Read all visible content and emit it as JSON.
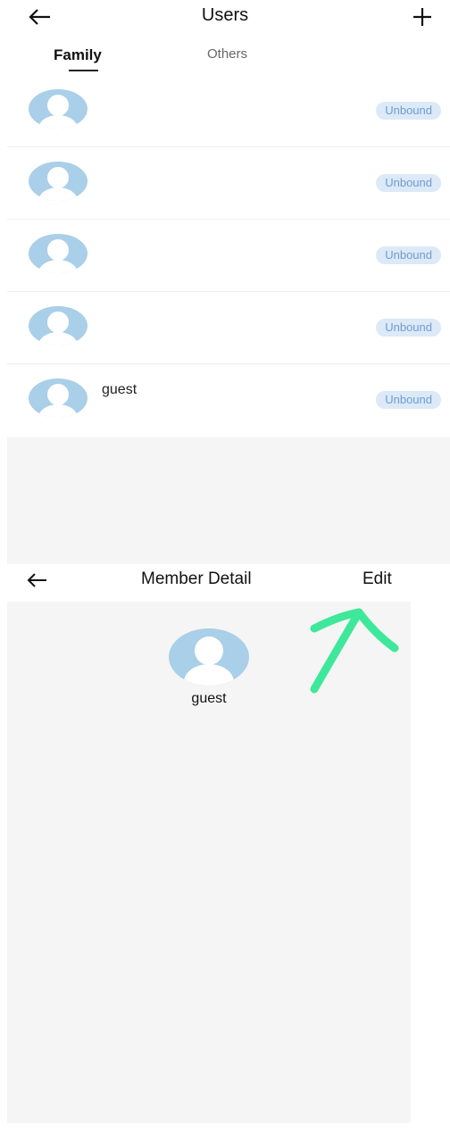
{
  "users_screen": {
    "title": "Users",
    "tabs": [
      {
        "label": "Family",
        "active": true
      },
      {
        "label": "Others",
        "active": false
      }
    ],
    "members": [
      {
        "name": "",
        "status": "Unbound"
      },
      {
        "name": "",
        "status": "Unbound"
      },
      {
        "name": "",
        "status": "Unbound"
      },
      {
        "name": "",
        "status": "Unbound"
      },
      {
        "name": "guest",
        "status": "Unbound"
      }
    ]
  },
  "detail_screen": {
    "title": "Member Detail",
    "edit_label": "Edit",
    "member_name": "guest"
  },
  "icons": {
    "back": "arrow-left-icon",
    "add": "plus-icon",
    "avatar": "user-avatar-icon",
    "annotation": "arrow-annotation"
  },
  "colors": {
    "avatar_bg": "#a9cfe9",
    "badge_bg": "#dce9f7",
    "badge_text": "#6f9dd0",
    "annotation": "#3ee89a",
    "panel_bg": "#f5f5f5"
  }
}
